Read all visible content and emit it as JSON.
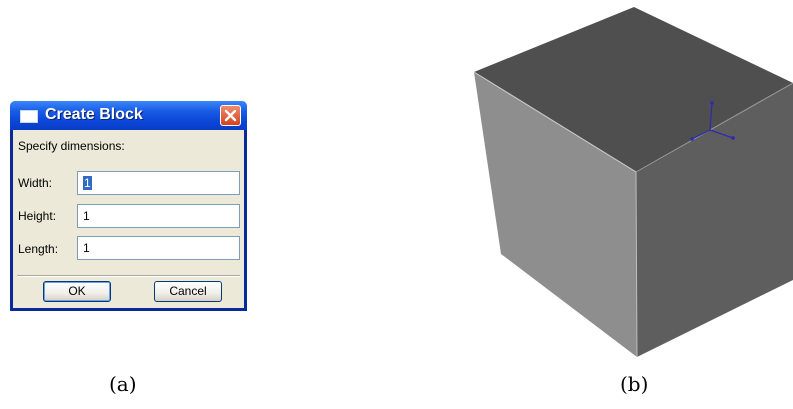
{
  "dialog": {
    "title": "Create Block",
    "prompt": "Specify dimensions:",
    "fields": [
      {
        "label": "Width:",
        "value": "1",
        "selected": true
      },
      {
        "label": "Height:",
        "value": "1",
        "selected": false
      },
      {
        "label": "Length:",
        "value": "1",
        "selected": false
      }
    ],
    "ok_label": "OK",
    "cancel_label": "Cancel"
  },
  "captions": {
    "a": "(a)",
    "b": "(b)"
  },
  "colors": {
    "titlebar": "#0b46d8",
    "cube_top": "#4f4f4f",
    "cube_left": "#8e8e8e",
    "cube_right": "#5e5e5e",
    "axis_triad": "#2b2bb0"
  }
}
